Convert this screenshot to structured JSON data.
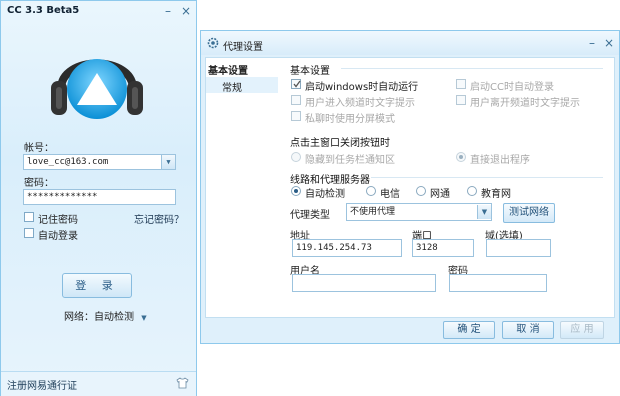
{
  "login": {
    "title": "CC 3.3 Beta5",
    "account_label": "帐号：",
    "account_value": "love_cc@163.com",
    "password_label": "密码：",
    "password_value": "*************",
    "remember_password": "记住密码",
    "forgot_password": "忘记密码？",
    "auto_login": "自动登录",
    "login_button": "登 录",
    "network_label": "网络：自动检测",
    "register": "注册网易通行证"
  },
  "proxy": {
    "title": "代理设置",
    "nav": {
      "group": "基本设置",
      "item": "常规"
    },
    "basic": {
      "heading": "基本设置",
      "options": {
        "autostart": "启动windows时自动运行",
        "auto_login_cc": "启动CC时自动登录",
        "channel_text_enter": "用户进入频道时文字提示",
        "channel_text_leave": "用户离开频道时文字提示",
        "private_split": "私聊时使用分屏模式"
      }
    },
    "close_section": {
      "heading": "点击主窗口关闭按钮时",
      "hide_to_tray": "隐藏到任务栏通知区",
      "exit_directly": "直接退出程序"
    },
    "line_section": {
      "heading": "线路和代理服务器",
      "options": [
        "自动检测",
        "电信",
        "网通",
        "教育网"
      ]
    },
    "proxy_type_label": "代理类型",
    "proxy_type_value": "不使用代理",
    "test_button": "测试网络",
    "address_label": "地址",
    "address_value": "119.145.254.73",
    "port_label": "端口",
    "port_value": "3128",
    "domain_label": "域(选填)",
    "username_label": "用户名",
    "password_label": "密码",
    "ok_button": "确 定",
    "cancel_button": "取 消",
    "apply_button": "应 用"
  }
}
